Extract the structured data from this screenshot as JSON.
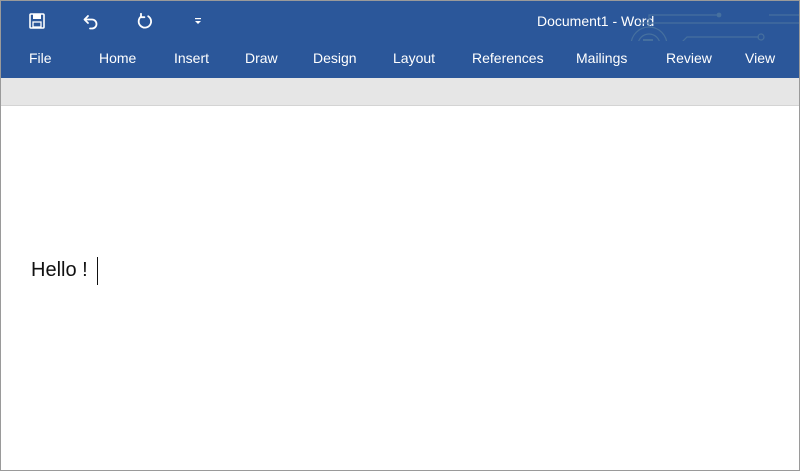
{
  "app": {
    "window_title": "Document1 - Word"
  },
  "quick_access": {
    "save_icon": "floppy-disk-icon",
    "undo_icon": "undo-arrow-icon",
    "redo_icon": "redo-circular-arrow-icon",
    "customize_icon": "customize-dropdown-icon"
  },
  "tabs": [
    {
      "label": "File"
    },
    {
      "label": "Home"
    },
    {
      "label": "Insert"
    },
    {
      "label": "Draw"
    },
    {
      "label": "Design"
    },
    {
      "label": "Layout"
    },
    {
      "label": "References"
    },
    {
      "label": "Mailings"
    },
    {
      "label": "Review"
    },
    {
      "label": "View"
    }
  ],
  "document": {
    "text": "Hello !"
  },
  "colors": {
    "ribbon_blue": "#2b579a",
    "ribbon_strip_gray": "#e6e6e6",
    "page_white": "#ffffff",
    "text": "#111111"
  }
}
